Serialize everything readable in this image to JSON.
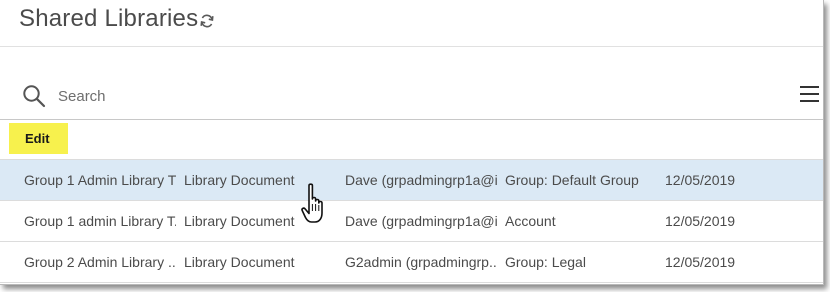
{
  "header": {
    "title": "Shared Libraries",
    "refresh_icon": "refresh-icon"
  },
  "search": {
    "placeholder": "Search",
    "value": "",
    "icon": "search-icon",
    "menu_icon": "hamburger-menu-icon"
  },
  "toolbar": {
    "edit_label": "Edit",
    "edit_color": "#f7f14d"
  },
  "table": {
    "selected_color": "#dbe9f5",
    "rows": [
      {
        "name": "Group 1 Admin Library T...",
        "type": "Library Document",
        "owner": "Dave (grpadmingrp1a@i...",
        "scope": "Group: Default Group",
        "date": "12/05/2019",
        "selected": true
      },
      {
        "name": "Group 1 admin Library T...",
        "type": "Library Document",
        "owner": "Dave (grpadmingrp1a@i...",
        "scope": "Account",
        "date": "12/05/2019",
        "selected": false
      },
      {
        "name": "Group 2 Admin Library ...",
        "type": "Library Document",
        "owner": "G2admin (grpadmingrp...",
        "scope": "Group: Legal",
        "date": "12/05/2019",
        "selected": false
      }
    ]
  },
  "pointer": "hand-pointer-cursor-icon"
}
